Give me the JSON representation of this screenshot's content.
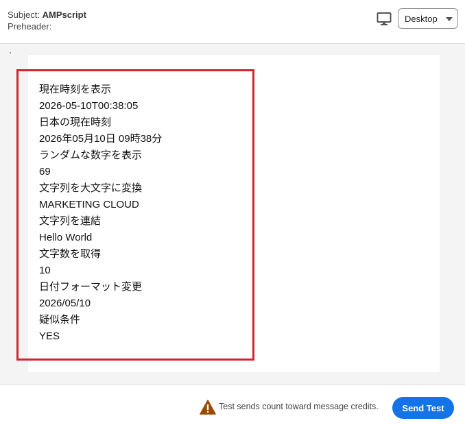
{
  "header": {
    "subject_label": "Subject:",
    "subject_value": "AMPscript",
    "preheader_label": "Preheader:",
    "device_icon": "desktop-monitor-icon",
    "device_select_value": "Desktop"
  },
  "preview": {
    "lines": [
      "現在時刻を表示",
      "2026-05-10T00:38:05",
      "日本の現在時刻",
      "2026年05月10日 09時38分",
      "ランダムな数字を表示",
      "69",
      "文字列を大文字に変換",
      "MARKETING CLOUD",
      "文字列を連結",
      "Hello World",
      "文字数を取得",
      "10",
      "日付フォーマット変更",
      "2026/05/10",
      "疑似条件",
      "YES"
    ],
    "highlight_color": "#d3232f"
  },
  "footer": {
    "warning_icon": "warning-triangle-icon",
    "warning_text": "Test sends count toward message credits.",
    "send_button_label": "Send Test",
    "accent_color": "#1473e6"
  }
}
